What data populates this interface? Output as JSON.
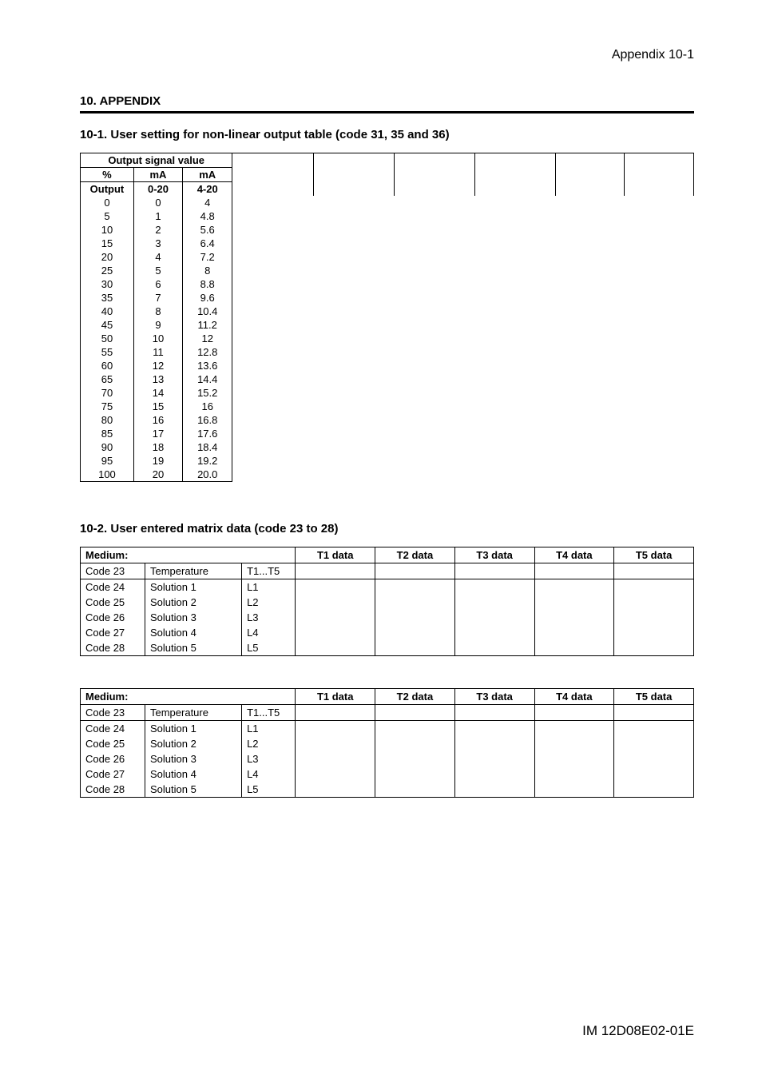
{
  "header": {
    "appendix_label": "Appendix 10-1"
  },
  "section": {
    "title": "10. APPENDIX",
    "sub1": "10-1. User setting for non-linear output table (code 31, 35 and 36)",
    "sub2": "10-2. User entered matrix data (code 23 to 28)"
  },
  "table1": {
    "group_header": "Output signal value",
    "h_pct": "%",
    "h_ma1": "mA",
    "h_ma2": "mA",
    "h_output": "Output",
    "h_020": "0-20",
    "h_420": "4-20",
    "rows": [
      {
        "p": "0",
        "a": "0",
        "b": "4"
      },
      {
        "p": "5",
        "a": "1",
        "b": "4.8"
      },
      {
        "p": "10",
        "a": "2",
        "b": "5.6"
      },
      {
        "p": "15",
        "a": "3",
        "b": "6.4"
      },
      {
        "p": "20",
        "a": "4",
        "b": "7.2"
      },
      {
        "p": "25",
        "a": "5",
        "b": "8"
      },
      {
        "p": "30",
        "a": "6",
        "b": "8.8"
      },
      {
        "p": "35",
        "a": "7",
        "b": "9.6"
      },
      {
        "p": "40",
        "a": "8",
        "b": "10.4"
      },
      {
        "p": "45",
        "a": "9",
        "b": "11.2"
      },
      {
        "p": "50",
        "a": "10",
        "b": "12"
      },
      {
        "p": "55",
        "a": "11",
        "b": "12.8"
      },
      {
        "p": "60",
        "a": "12",
        "b": "13.6"
      },
      {
        "p": "65",
        "a": "13",
        "b": "14.4"
      },
      {
        "p": "70",
        "a": "14",
        "b": "15.2"
      },
      {
        "p": "75",
        "a": "15",
        "b": "16"
      },
      {
        "p": "80",
        "a": "16",
        "b": "16.8"
      },
      {
        "p": "85",
        "a": "17",
        "b": "17.6"
      },
      {
        "p": "90",
        "a": "18",
        "b": "18.4"
      },
      {
        "p": "95",
        "a": "19",
        "b": "19.2"
      },
      {
        "p": "100",
        "a": "20",
        "b": "20.0"
      }
    ]
  },
  "matrix": {
    "medium_label": "Medium:",
    "headers": {
      "t1": "T1 data",
      "t2": "T2 data",
      "t3": "T3 data",
      "t4": "T4 data",
      "t5": "T5 data"
    },
    "rows": [
      {
        "code": "Code 23",
        "desc": "Temperature",
        "l": "T1...T5"
      },
      {
        "code": "Code 24",
        "desc": "Solution 1",
        "l": "L1"
      },
      {
        "code": "Code 25",
        "desc": "Solution 2",
        "l": "L2"
      },
      {
        "code": "Code 26",
        "desc": "Solution 3",
        "l": "L3"
      },
      {
        "code": "Code 27",
        "desc": "Solution 4",
        "l": "L4"
      },
      {
        "code": "Code 28",
        "desc": "Solution 5",
        "l": "L5"
      }
    ]
  },
  "footer": {
    "doc_id": "IM 12D08E02-01E"
  }
}
